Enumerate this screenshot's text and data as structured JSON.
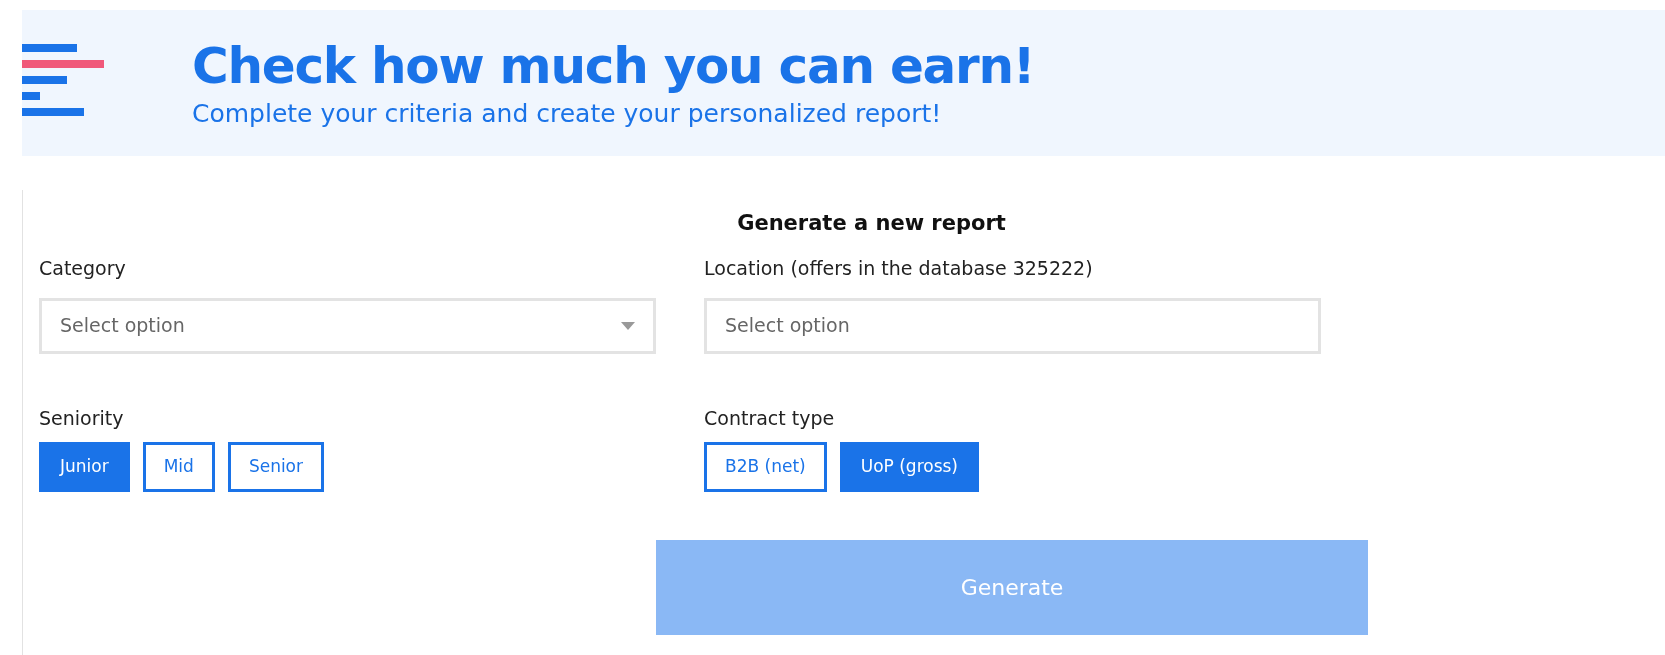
{
  "header": {
    "title": "Check how much you can earn!",
    "subtitle": "Complete your criteria and create your personalized report!"
  },
  "form": {
    "title": "Generate a new report",
    "category": {
      "label": "Category",
      "placeholder": "Select option"
    },
    "location": {
      "label": "Location (offers in the database 325222)",
      "placeholder": "Select option"
    },
    "seniority": {
      "label": "Seniority",
      "options": [
        {
          "label": "Junior",
          "selected": true
        },
        {
          "label": "Mid",
          "selected": false
        },
        {
          "label": "Senior",
          "selected": false
        }
      ]
    },
    "contract_type": {
      "label": "Contract type",
      "options": [
        {
          "label": "B2B (net)",
          "selected": false
        },
        {
          "label": "UoP (gross)",
          "selected": true
        }
      ]
    },
    "generate_button": {
      "label": "Generate",
      "disabled": true
    }
  }
}
